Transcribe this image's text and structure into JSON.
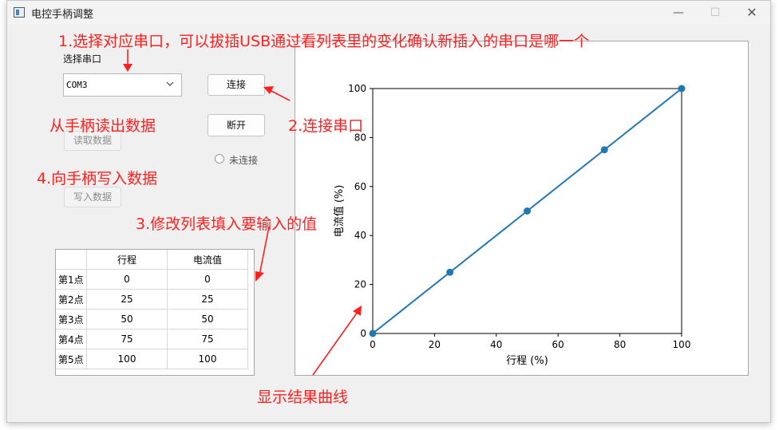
{
  "window": {
    "title": "电控手柄调整",
    "controls": {
      "minimize": "—",
      "maximize": "☐",
      "close": "✕"
    }
  },
  "serial": {
    "label": "选择串口",
    "selected_port": "COM3",
    "connect_button": "连接",
    "disconnect_button": "断开",
    "status": "未连接"
  },
  "data_buttons": {
    "read": "读取数据",
    "write": "写入数据"
  },
  "table": {
    "headers": [
      "行程",
      "电流值"
    ],
    "rows": [
      {
        "label": "第1点",
        "travel": "0",
        "current": "0"
      },
      {
        "label": "第2点",
        "travel": "25",
        "current": "25"
      },
      {
        "label": "第3点",
        "travel": "50",
        "current": "50"
      },
      {
        "label": "第4点",
        "travel": "75",
        "current": "75"
      },
      {
        "label": "第5点",
        "travel": "100",
        "current": "100"
      }
    ]
  },
  "annotations": {
    "step1": "1.选择对应串口，可以拔插USB通过看列表里的变化确认新插入的串口是哪一个",
    "step2": "2.连接串口",
    "step3": "3.修改列表填入要输入的值",
    "step4": "4.向手柄写入数据",
    "read_note": "从手柄读出数据",
    "curve_note": "显示结果曲线",
    "color": "#ff1f1f"
  },
  "chart_data": {
    "type": "line",
    "x": [
      0,
      25,
      50,
      75,
      100
    ],
    "y": [
      0,
      25,
      50,
      75,
      100
    ],
    "xlabel": "行程 (%)",
    "ylabel": "电流值 (%)",
    "xlim": [
      0,
      100
    ],
    "ylim": [
      0,
      100
    ],
    "xticks": [
      0,
      20,
      40,
      60,
      80,
      100
    ],
    "yticks": [
      0,
      20,
      40,
      60,
      80,
      100
    ],
    "grid": false,
    "line_color": "#1f77b4"
  }
}
